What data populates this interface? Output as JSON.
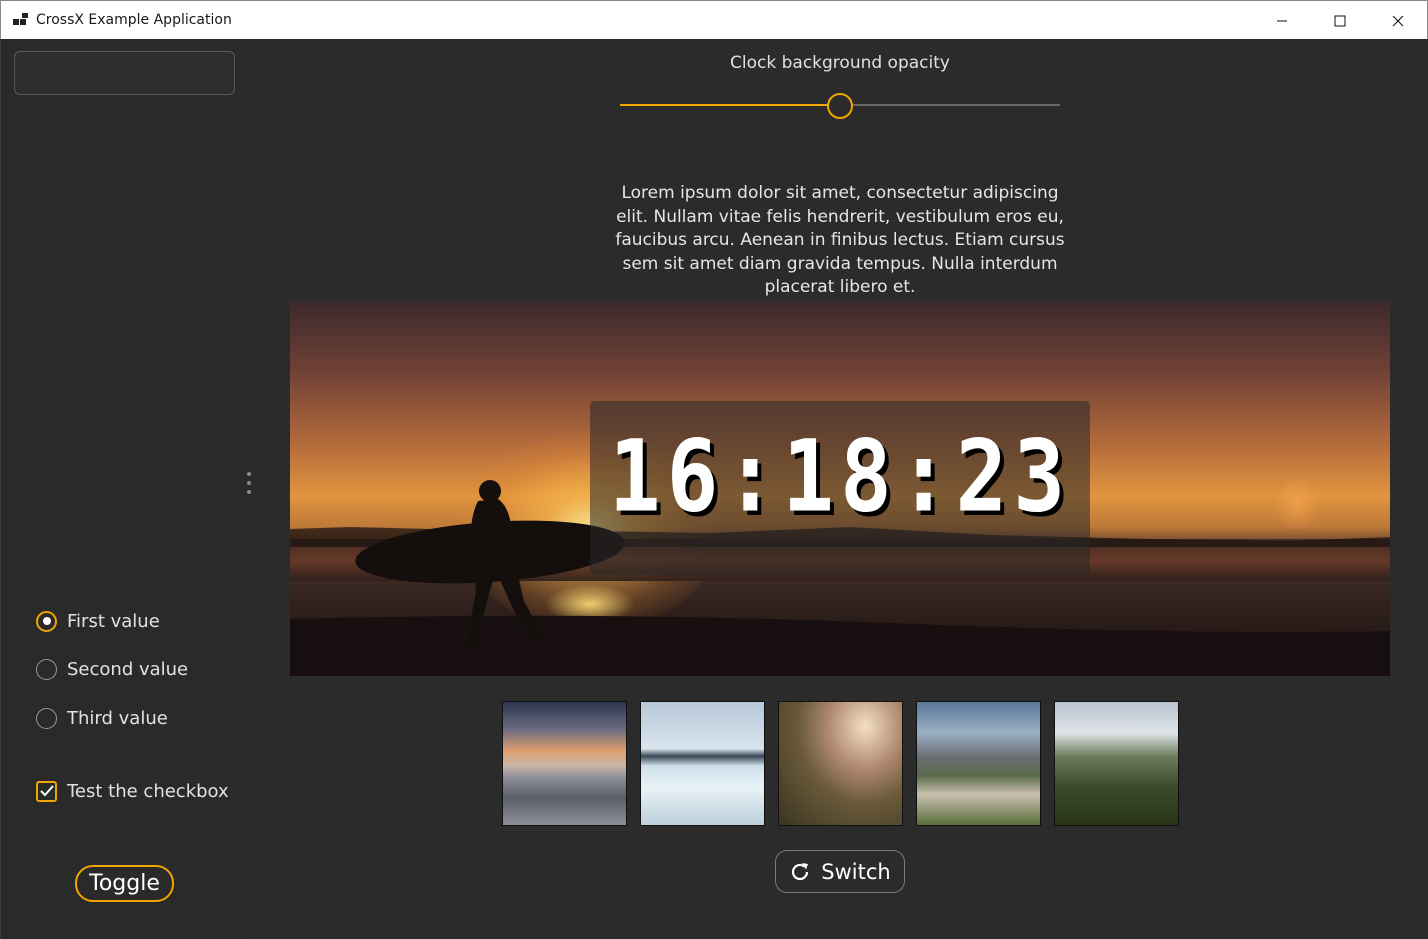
{
  "window": {
    "title": "CrossX Example Application",
    "minimize_icon": "minimize-icon",
    "maximize_icon": "maximize-icon",
    "close_icon": "close-icon"
  },
  "sidebar": {
    "input_value": "",
    "radio_options": [
      {
        "label": "First value",
        "checked": true
      },
      {
        "label": "Second value",
        "checked": false
      },
      {
        "label": "Third value",
        "checked": false
      }
    ],
    "checkbox": {
      "label": "Test the checkbox",
      "checked": true
    },
    "toggle_label": "Toggle"
  },
  "main": {
    "slider": {
      "label": "Clock background opacity",
      "value": 0.5
    },
    "lorem": "Lorem ipsum dolor sit amet, consectetur adipiscing elit. Nullam vitae felis hendrerit, vestibulum eros eu, faucibus arcu. Aenean in finibus lectus. Etiam cursus sem sit amet diam gravida tempus. Nulla interdum placerat libero et.",
    "clock": "16:18:23",
    "thumbnails": [
      "sunset-beach",
      "hot-spring",
      "cactus",
      "castle",
      "dandelions"
    ],
    "switch_label": "Switch",
    "switch_icon": "refresh-icon"
  },
  "colors": {
    "accent": "#f0a500",
    "background": "#2b2b2b"
  }
}
